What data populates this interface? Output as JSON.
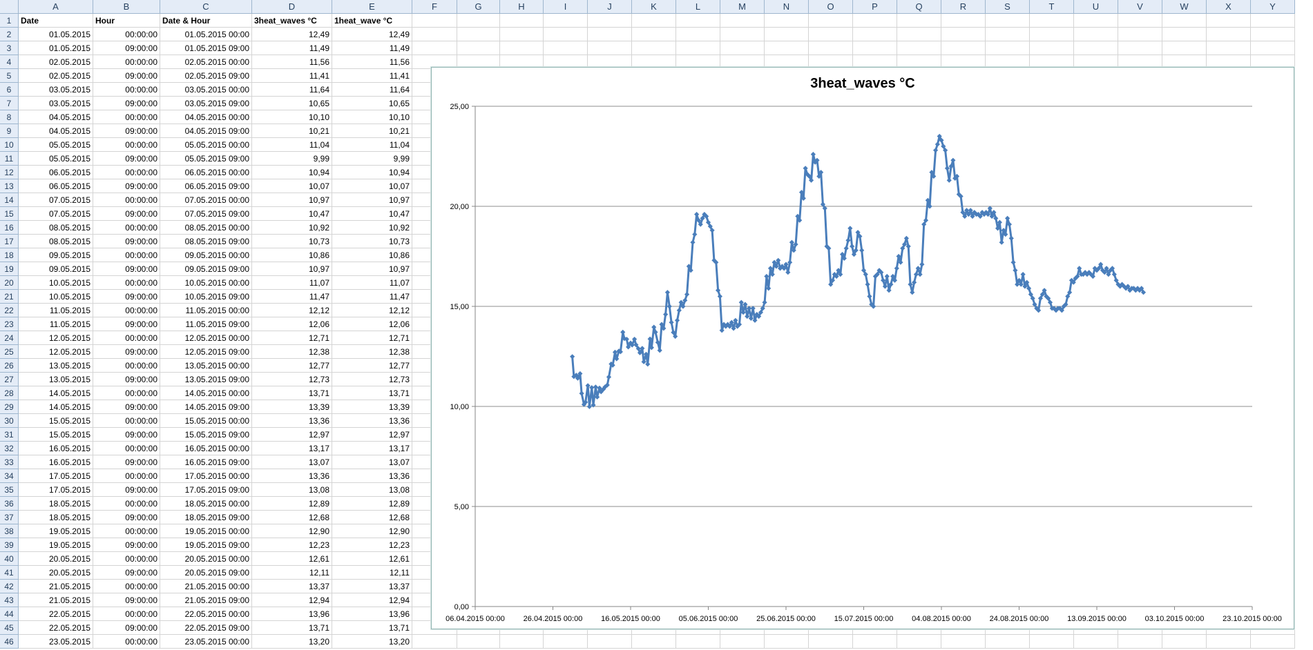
{
  "sheet": {
    "columns": [
      "A",
      "B",
      "C",
      "D",
      "E",
      "F",
      "G",
      "H",
      "I",
      "J",
      "K",
      "L",
      "M",
      "N",
      "O",
      "P",
      "Q",
      "R",
      "S",
      "T",
      "U",
      "V",
      "W",
      "X",
      "Y"
    ],
    "header_row": [
      "Date",
      "Hour",
      "Date & Hour",
      "3heat_waves °C",
      "1heat_wave °C"
    ],
    "rows": [
      [
        "01.05.2015",
        "00:00:00",
        "01.05.2015 00:00",
        "12,49",
        "12,49"
      ],
      [
        "01.05.2015",
        "09:00:00",
        "01.05.2015 09:00",
        "11,49",
        "11,49"
      ],
      [
        "02.05.2015",
        "00:00:00",
        "02.05.2015 00:00",
        "11,56",
        "11,56"
      ],
      [
        "02.05.2015",
        "09:00:00",
        "02.05.2015 09:00",
        "11,41",
        "11,41"
      ],
      [
        "03.05.2015",
        "00:00:00",
        "03.05.2015 00:00",
        "11,64",
        "11,64"
      ],
      [
        "03.05.2015",
        "09:00:00",
        "03.05.2015 09:00",
        "10,65",
        "10,65"
      ],
      [
        "04.05.2015",
        "00:00:00",
        "04.05.2015 00:00",
        "10,10",
        "10,10"
      ],
      [
        "04.05.2015",
        "09:00:00",
        "04.05.2015 09:00",
        "10,21",
        "10,21"
      ],
      [
        "05.05.2015",
        "00:00:00",
        "05.05.2015 00:00",
        "11,04",
        "11,04"
      ],
      [
        "05.05.2015",
        "09:00:00",
        "05.05.2015 09:00",
        "9,99",
        "9,99"
      ],
      [
        "06.05.2015",
        "00:00:00",
        "06.05.2015 00:00",
        "10,94",
        "10,94"
      ],
      [
        "06.05.2015",
        "09:00:00",
        "06.05.2015 09:00",
        "10,07",
        "10,07"
      ],
      [
        "07.05.2015",
        "00:00:00",
        "07.05.2015 00:00",
        "10,97",
        "10,97"
      ],
      [
        "07.05.2015",
        "09:00:00",
        "07.05.2015 09:00",
        "10,47",
        "10,47"
      ],
      [
        "08.05.2015",
        "00:00:00",
        "08.05.2015 00:00",
        "10,92",
        "10,92"
      ],
      [
        "08.05.2015",
        "09:00:00",
        "08.05.2015 09:00",
        "10,73",
        "10,73"
      ],
      [
        "09.05.2015",
        "00:00:00",
        "09.05.2015 00:00",
        "10,86",
        "10,86"
      ],
      [
        "09.05.2015",
        "09:00:00",
        "09.05.2015 09:00",
        "10,97",
        "10,97"
      ],
      [
        "10.05.2015",
        "00:00:00",
        "10.05.2015 00:00",
        "11,07",
        "11,07"
      ],
      [
        "10.05.2015",
        "09:00:00",
        "10.05.2015 09:00",
        "11,47",
        "11,47"
      ],
      [
        "11.05.2015",
        "00:00:00",
        "11.05.2015 00:00",
        "12,12",
        "12,12"
      ],
      [
        "11.05.2015",
        "09:00:00",
        "11.05.2015 09:00",
        "12,06",
        "12,06"
      ],
      [
        "12.05.2015",
        "00:00:00",
        "12.05.2015 00:00",
        "12,71",
        "12,71"
      ],
      [
        "12.05.2015",
        "09:00:00",
        "12.05.2015 09:00",
        "12,38",
        "12,38"
      ],
      [
        "13.05.2015",
        "00:00:00",
        "13.05.2015 00:00",
        "12,77",
        "12,77"
      ],
      [
        "13.05.2015",
        "09:00:00",
        "13.05.2015 09:00",
        "12,73",
        "12,73"
      ],
      [
        "14.05.2015",
        "00:00:00",
        "14.05.2015 00:00",
        "13,71",
        "13,71"
      ],
      [
        "14.05.2015",
        "09:00:00",
        "14.05.2015 09:00",
        "13,39",
        "13,39"
      ],
      [
        "15.05.2015",
        "00:00:00",
        "15.05.2015 00:00",
        "13,36",
        "13,36"
      ],
      [
        "15.05.2015",
        "09:00:00",
        "15.05.2015 09:00",
        "12,97",
        "12,97"
      ],
      [
        "16.05.2015",
        "00:00:00",
        "16.05.2015 00:00",
        "13,17",
        "13,17"
      ],
      [
        "16.05.2015",
        "09:00:00",
        "16.05.2015 09:00",
        "13,07",
        "13,07"
      ],
      [
        "17.05.2015",
        "00:00:00",
        "17.05.2015 00:00",
        "13,36",
        "13,36"
      ],
      [
        "17.05.2015",
        "09:00:00",
        "17.05.2015 09:00",
        "13,08",
        "13,08"
      ],
      [
        "18.05.2015",
        "00:00:00",
        "18.05.2015 00:00",
        "12,89",
        "12,89"
      ],
      [
        "18.05.2015",
        "09:00:00",
        "18.05.2015 09:00",
        "12,68",
        "12,68"
      ],
      [
        "19.05.2015",
        "00:00:00",
        "19.05.2015 00:00",
        "12,90",
        "12,90"
      ],
      [
        "19.05.2015",
        "09:00:00",
        "19.05.2015 09:00",
        "12,23",
        "12,23"
      ],
      [
        "20.05.2015",
        "00:00:00",
        "20.05.2015 00:00",
        "12,61",
        "12,61"
      ],
      [
        "20.05.2015",
        "09:00:00",
        "20.05.2015 09:00",
        "12,11",
        "12,11"
      ],
      [
        "21.05.2015",
        "00:00:00",
        "21.05.2015 00:00",
        "13,37",
        "13,37"
      ],
      [
        "21.05.2015",
        "09:00:00",
        "21.05.2015 09:00",
        "12,94",
        "12,94"
      ],
      [
        "22.05.2015",
        "00:00:00",
        "22.05.2015 00:00",
        "13,96",
        "13,96"
      ],
      [
        "22.05.2015",
        "09:00:00",
        "22.05.2015 09:00",
        "13,71",
        "13,71"
      ],
      [
        "23.05.2015",
        "00:00:00",
        "23.05.2015 00:00",
        "13,20",
        "13,20"
      ]
    ]
  },
  "chart_data": {
    "type": "line",
    "title": "3heat_waves °C",
    "xlabel": "",
    "ylabel": "",
    "ylim": [
      0,
      25
    ],
    "y_ticks": [
      "0,00",
      "5,00",
      "10,00",
      "15,00",
      "20,00",
      "25,00"
    ],
    "x_ticks": [
      "06.04.2015 00:00",
      "26.04.2015 00:00",
      "16.05.2015 00:00",
      "05.06.2015 00:00",
      "25.06.2015 00:00",
      "15.07.2015 00:00",
      "04.08.2015 00:00",
      "24.08.2015 00:00",
      "13.09.2015 00:00",
      "03.10.2015 00:00",
      "23.10.2015 00:00"
    ],
    "x_range_days": [
      0,
      200
    ],
    "grid": true,
    "legend": "none",
    "series_color": "#4a7ebb",
    "series": [
      {
        "x_days": [
          25,
          25.4,
          26,
          26.4,
          27,
          27.4,
          28,
          28.4,
          29,
          29.4,
          30,
          30.4,
          31,
          31.4,
          32,
          32.4,
          33,
          33.4,
          34,
          34.4,
          35,
          35.4,
          36,
          36.4,
          37,
          37.4,
          38,
          38.4,
          39,
          39.4,
          40,
          40.4,
          41,
          41.4,
          42,
          42.4,
          43,
          43.4,
          44,
          44.4,
          45,
          45.4,
          46,
          46.4,
          47,
          47.5,
          48,
          48.5,
          49,
          49.5,
          50,
          50.5,
          51,
          51.5,
          52,
          52.5,
          53,
          53.5,
          54,
          54.5,
          55,
          55.5,
          56,
          56.5,
          57,
          57.5,
          58,
          58.5,
          59,
          59.5,
          60,
          60.5,
          61,
          61.5,
          62,
          62.5,
          63,
          63.5,
          64,
          64.5,
          65,
          65.5,
          66,
          66.5,
          67,
          67.5,
          68,
          68.5,
          69,
          69.5,
          70,
          70.5,
          71,
          71.5,
          72,
          72.5,
          73,
          73.5,
          74,
          74.5,
          75,
          75.5,
          76,
          76.5,
          77,
          77.5,
          78,
          78.5,
          79,
          79.5,
          80,
          80.5,
          81,
          81.5,
          82,
          82.5,
          83,
          83.5,
          84,
          84.5,
          85,
          85.5,
          86,
          86.5,
          87,
          87.5,
          88,
          88.5,
          89,
          89.5,
          90,
          90.5,
          91,
          91.5,
          92,
          92.5,
          93,
          93.5,
          94,
          94.5,
          95,
          95.5,
          96,
          96.5,
          97,
          97.5,
          98,
          98.5,
          99,
          99.5,
          100,
          100.5,
          101,
          101.5,
          102,
          102.5,
          103,
          103.5,
          104,
          104.5,
          105,
          105.5,
          106,
          106.5,
          107,
          107.5,
          108,
          108.5,
          109,
          109.5,
          110,
          110.5,
          111,
          111.5,
          112,
          112.5,
          113,
          113.5,
          114,
          114.5,
          115,
          115.5,
          116,
          116.5,
          117,
          117.5,
          118,
          118.5,
          119,
          119.5,
          120,
          120.5,
          121,
          121.5,
          122,
          122.5,
          123,
          123.5,
          124,
          124.5,
          125,
          125.5,
          126,
          126.5,
          127,
          127.5,
          128,
          128.5,
          129,
          129.5,
          130,
          130.5,
          131,
          131.5,
          132,
          132.5,
          133,
          133.5,
          134,
          134.5,
          135,
          135.5,
          136,
          136.5,
          137,
          137.5,
          138,
          138.5,
          139,
          139.5,
          140,
          140.5,
          141,
          141.5,
          142,
          142.5,
          143,
          143.5,
          144,
          144.5,
          145,
          145.5,
          146,
          146.5,
          147,
          147.5,
          148,
          148.5,
          149,
          149.5,
          150,
          150.5,
          151,
          151.5,
          152,
          152.5,
          153,
          153.5,
          154,
          154.5,
          155,
          155.5,
          156,
          156.5,
          157,
          157.5,
          158,
          158.5,
          159,
          159.5,
          160,
          160.5,
          161,
          161.5,
          162,
          162.5,
          163,
          163.5,
          164,
          164.5,
          165,
          165.5,
          166,
          166.5,
          167,
          167.5,
          168,
          168.5,
          169,
          169.5,
          170,
          170.5,
          171,
          171.5,
          172,
          172.5,
          173,
          173.5,
          174,
          174.5,
          175
        ],
        "values": [
          12.49,
          11.49,
          11.56,
          11.41,
          11.64,
          10.65,
          10.1,
          10.21,
          11.04,
          9.99,
          10.94,
          10.07,
          10.97,
          10.47,
          10.92,
          10.73,
          10.86,
          10.97,
          11.07,
          11.47,
          12.12,
          12.06,
          12.71,
          12.38,
          12.77,
          12.73,
          13.71,
          13.39,
          13.36,
          12.97,
          13.17,
          13.07,
          13.36,
          13.08,
          12.89,
          12.68,
          12.9,
          12.23,
          12.61,
          12.11,
          13.37,
          12.94,
          13.96,
          13.71,
          13.2,
          12.8,
          14.1,
          13.9,
          14.6,
          15.7,
          15.0,
          14.2,
          13.7,
          13.5,
          14.3,
          14.8,
          15.2,
          15.0,
          15.3,
          15.6,
          17.0,
          16.8,
          18.2,
          18.6,
          19.6,
          19.3,
          19.1,
          19.4,
          19.6,
          19.5,
          19.2,
          19.0,
          18.8,
          17.3,
          17.2,
          15.8,
          15.5,
          13.8,
          14.1,
          14.0,
          14.1,
          14.0,
          14.2,
          13.9,
          14.3,
          14.0,
          14.1,
          15.2,
          14.7,
          15.1,
          14.5,
          14.9,
          14.4,
          14.9,
          14.3,
          14.6,
          14.5,
          14.7,
          14.9,
          15.2,
          16.5,
          15.9,
          16.9,
          16.6,
          17.2,
          17.0,
          17.3,
          16.9,
          17.0,
          16.9,
          17.1,
          16.7,
          17.2,
          18.2,
          17.8,
          18.1,
          19.5,
          19.3,
          20.7,
          20.4,
          21.9,
          21.6,
          21.5,
          21.3,
          22.6,
          22.2,
          22.3,
          21.5,
          21.7,
          20.1,
          19.9,
          18.0,
          17.9,
          16.1,
          16.3,
          16.6,
          16.5,
          16.8,
          16.6,
          17.6,
          17.4,
          17.9,
          18.3,
          18.9,
          18.0,
          17.6,
          17.8,
          18.7,
          18.5,
          17.8,
          16.8,
          16.6,
          16.1,
          15.5,
          15.1,
          15.0,
          16.5,
          16.6,
          16.8,
          16.7,
          16.3,
          16.0,
          16.5,
          15.8,
          16.1,
          16.5,
          16.3,
          16.9,
          17.5,
          17.2,
          17.9,
          18.1,
          18.4,
          18.0,
          16.1,
          15.7,
          16.2,
          16.6,
          16.9,
          16.6,
          17.1,
          19.1,
          19.3,
          20.3,
          20.0,
          21.7,
          21.5,
          22.8,
          23.1,
          23.5,
          23.3,
          23.0,
          22.8,
          21.9,
          21.3,
          22.0,
          22.3,
          21.4,
          21.5,
          20.6,
          20.5,
          19.7,
          19.5,
          19.8,
          19.6,
          19.8,
          19.5,
          19.7,
          19.6,
          19.6,
          19.5,
          19.7,
          19.6,
          19.7,
          19.6,
          19.9,
          19.5,
          19.7,
          19.4,
          18.9,
          19.2,
          18.2,
          18.8,
          18.6,
          19.4,
          19.1,
          18.4,
          17.2,
          16.8,
          16.1,
          16.3,
          16.1,
          16.6,
          16.0,
          16.2,
          15.9,
          15.6,
          15.4,
          15.1,
          14.9,
          14.8,
          15.4,
          15.6,
          15.8,
          15.5,
          15.4,
          15.2,
          14.9,
          14.9,
          14.8,
          14.9,
          14.9,
          14.8,
          15.0,
          15.1,
          15.5,
          15.7,
          16.3,
          16.2,
          16.4,
          16.5,
          16.9,
          16.6,
          16.6,
          16.7,
          16.6,
          16.7,
          16.6,
          16.5,
          16.9,
          16.8,
          16.9,
          17.1,
          16.8,
          16.7,
          16.9,
          16.6,
          16.8,
          16.9,
          16.6,
          16.3,
          16.1,
          16.0,
          16.1,
          16.0,
          15.9,
          16.0,
          15.8,
          15.9,
          15.9,
          15.8,
          15.9,
          15.8,
          15.9,
          15.7
        ]
      }
    ]
  }
}
